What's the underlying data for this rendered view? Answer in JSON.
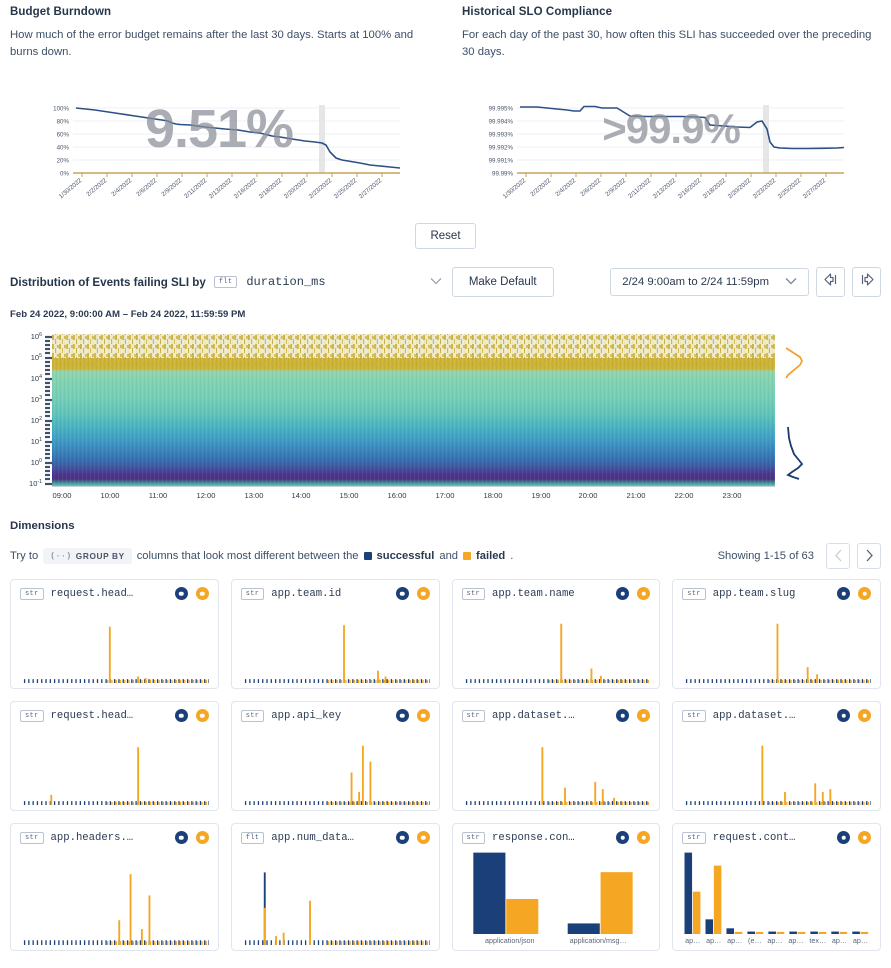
{
  "panels": [
    {
      "title": "Budget Burndown",
      "description": "How much of the error budget remains after the last 30 days. Starts at 100% and burns down.",
      "big_value": "9.51%"
    },
    {
      "title": "Historical SLO Compliance",
      "description": "For each day of the past 30, how often this SLI has succeeded over the preceding 30 days.",
      "big_value": ">99.9%"
    }
  ],
  "toolbar": {
    "reset_label": "Reset",
    "make_default_label": "Make Default",
    "distribution_label": "Distribution of Events failing SLI by",
    "column_type_badge": "flt",
    "column_name": "duration_ms",
    "chevron": "∨",
    "range_value": "2/24 9:00am to 2/24 11:59pm",
    "prev_icon": "arrow-left-bar-icon",
    "next_icon": "arrow-right-bar-icon",
    "subtitle": "Feb 24 2022, 9:00:00 AM – Feb 24 2022, 11:59:59 PM"
  },
  "dimensions": {
    "title": "Dimensions",
    "hint_prefix": "Try to",
    "group_by_label": "GROUP BY",
    "group_by_icon": "(··)",
    "hint_middle": "columns that look most different between the",
    "legend_successful": "successful",
    "hint_and": "and",
    "legend_failed": "failed",
    "hint_suffix": ".",
    "showing": "Showing 1-15 of 63",
    "prev_page_icon": "‹",
    "next_page_icon": "›"
  },
  "colors": {
    "successful": "#1b4079",
    "failed": "#f5a623",
    "line": "#2d4f86",
    "axis": "#c8a45c",
    "text": "#2a3f5f",
    "border": "#e1e6ee"
  },
  "cards": [
    {
      "type": "str",
      "name": "request.head…",
      "chart": "spike",
      "spike_at": 0.45,
      "spike_h": 0.78,
      "extras": [
        [
          0.6,
          0.09
        ],
        [
          0.64,
          0.07
        ]
      ]
    },
    {
      "type": "str",
      "name": "app.team.id",
      "chart": "spike",
      "spike_at": 0.52,
      "spike_h": 0.8,
      "extras": [
        [
          0.7,
          0.17
        ],
        [
          0.74,
          0.09
        ]
      ]
    },
    {
      "type": "str",
      "name": "app.team.name",
      "chart": "spike",
      "spike_at": 0.5,
      "spike_h": 0.82,
      "extras": [
        [
          0.66,
          0.2
        ],
        [
          0.71,
          0.1
        ]
      ]
    },
    {
      "type": "str",
      "name": "app.team.slug",
      "chart": "spike",
      "spike_at": 0.48,
      "spike_h": 0.82,
      "extras": [
        [
          0.64,
          0.22
        ],
        [
          0.69,
          0.12
        ]
      ]
    },
    {
      "type": "str",
      "name": "request.head…",
      "chart": "spike",
      "spike_at": 0.6,
      "spike_h": 0.8,
      "extras": [
        [
          0.14,
          0.14
        ]
      ]
    },
    {
      "type": "str",
      "name": "app.api_key",
      "chart": "spike",
      "spike_at": 0.62,
      "spike_h": 0.82,
      "extras": [
        [
          0.56,
          0.45
        ],
        [
          0.6,
          0.18
        ],
        [
          0.66,
          0.6
        ]
      ]
    },
    {
      "type": "str",
      "name": "app.dataset.…",
      "chart": "spike",
      "spike_at": 0.4,
      "spike_h": 0.8,
      "extras": [
        [
          0.52,
          0.24
        ],
        [
          0.68,
          0.32
        ],
        [
          0.72,
          0.22
        ],
        [
          0.78,
          0.1
        ]
      ]
    },
    {
      "type": "str",
      "name": "app.dataset.…",
      "chart": "spike",
      "spike_at": 0.4,
      "spike_h": 0.82,
      "extras": [
        [
          0.52,
          0.18
        ],
        [
          0.68,
          0.3
        ],
        [
          0.72,
          0.18
        ],
        [
          0.76,
          0.22
        ]
      ]
    },
    {
      "type": "str",
      "name": "app.headers.…",
      "chart": "spike",
      "spike_at": 0.56,
      "spike_h": 0.8,
      "extras": [
        [
          0.5,
          0.28
        ],
        [
          0.62,
          0.18
        ],
        [
          0.66,
          0.56
        ]
      ]
    },
    {
      "type": "flt",
      "name": "app.num_data…",
      "chart": "dual",
      "spike_at": 0.1,
      "spike_h": 0.82,
      "extras": [
        [
          0.1,
          0.42
        ],
        [
          0.16,
          0.1
        ],
        [
          0.2,
          0.14
        ],
        [
          0.34,
          0.5
        ]
      ]
    },
    {
      "type": "str",
      "name": "response.con…",
      "chart": "bars2",
      "categories": [
        "application/json",
        "application/msg…"
      ],
      "series": [
        {
          "name": "successful",
          "values": [
            1.0,
            0.13
          ]
        },
        {
          "name": "failed",
          "values": [
            0.43,
            0.76
          ]
        }
      ]
    },
    {
      "type": "str",
      "name": "request.cont…",
      "chart": "bars9",
      "categories": [
        "ap…",
        "ap…",
        "ap…",
        "(e…",
        "ap…",
        "ap…",
        "tex…",
        "ap…",
        "ap…"
      ],
      "series": [
        {
          "name": "successful",
          "values": [
            1.0,
            0.18,
            0.07,
            0.03,
            0.03,
            0.03,
            0.03,
            0.03,
            0.03
          ]
        },
        {
          "name": "failed",
          "values": [
            0.52,
            0.84,
            0.02,
            0.02,
            0.02,
            0.02,
            0.02,
            0.02,
            0.02
          ]
        }
      ]
    }
  ],
  "chart_data": [
    {
      "type": "line",
      "title": "Budget Burndown",
      "xlabel": "",
      "ylabel": "",
      "ylim": [
        0,
        100
      ],
      "ytick_labels": [
        "100%",
        "80%",
        "60%",
        "40%",
        "20%",
        "0%"
      ],
      "x": [
        "1/30/2022",
        "2/2/2022",
        "2/4/2022",
        "2/6/2022",
        "2/9/2022",
        "2/11/2022",
        "2/13/2022",
        "2/16/2022",
        "2/18/2022",
        "2/20/2022",
        "2/23/2022",
        "2/25/2022",
        "2/27/2022"
      ],
      "values": [
        100,
        93,
        88,
        84,
        80,
        78,
        72,
        68,
        63,
        60,
        56,
        52,
        48,
        45,
        44,
        43,
        30,
        22,
        20,
        15,
        13,
        12,
        11,
        10,
        9.51
      ],
      "big_label": "9.51%",
      "grid": true,
      "legend": "none"
    },
    {
      "type": "line",
      "title": "Historical SLO Compliance",
      "xlabel": "",
      "ylabel": "",
      "ylim": [
        99.99,
        99.9955
      ],
      "ytick_labels": [
        "99.995%",
        "99.994%",
        "99.993%",
        "99.992%",
        "99.991%",
        "99.99%"
      ],
      "x": [
        "1/30/2022",
        "2/2/2022",
        "2/4/2022",
        "2/6/2022",
        "2/9/2022",
        "2/11/2022",
        "2/13/2022",
        "2/16/2022",
        "2/18/2022",
        "2/20/2022",
        "2/23/2022",
        "2/25/2022",
        "2/27/2022"
      ],
      "values": [
        99.9951,
        99.9951,
        99.995,
        99.9949,
        99.9948,
        99.9951,
        99.995,
        99.995,
        99.9944,
        99.9944,
        99.9944,
        99.99435,
        99.99435,
        99.9944,
        99.9943,
        99.993,
        99.9929,
        99.9929,
        99.9934,
        99.99345,
        99.9925,
        99.99105,
        99.99105,
        99.991,
        99.991,
        99.9911
      ],
      "big_label": ">99.9%",
      "grid": true,
      "legend": "none"
    },
    {
      "type": "heatmap",
      "title": "Distribution of Events failing SLI by duration_ms",
      "xlabel": "",
      "ylabel": "duration_ms",
      "ytick_labels": [
        "10⁶",
        "10⁵",
        "10⁴",
        "10³",
        "10²",
        "10¹",
        "10⁰",
        "10⁻¹"
      ],
      "xtick_labels": [
        "09:00",
        "10:00",
        "11:00",
        "12:00",
        "13:00",
        "14:00",
        "15:00",
        "16:00",
        "17:00",
        "18:00",
        "19:00",
        "20:00",
        "21:00",
        "22:00",
        "23:00"
      ],
      "yscale": "log",
      "colormap": "viridis",
      "grid": false
    }
  ]
}
